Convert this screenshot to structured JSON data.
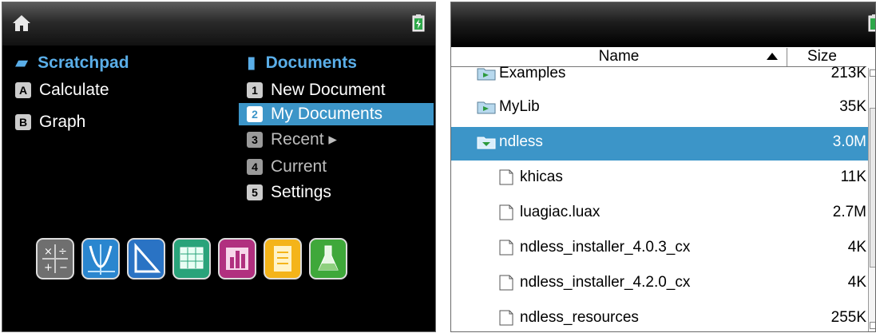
{
  "left_screen": {
    "scratchpad": {
      "title": "Scratchpad",
      "items": [
        {
          "key": "A",
          "label": "Calculate"
        },
        {
          "key": "B",
          "label": "Graph"
        }
      ]
    },
    "documents": {
      "title": "Documents",
      "items": [
        {
          "key": "1",
          "label": "New Document",
          "state": "normal"
        },
        {
          "key": "2",
          "label": "My Documents",
          "state": "selected"
        },
        {
          "key": "3",
          "label": "Recent ▸",
          "state": "dim"
        },
        {
          "key": "4",
          "label": "Current",
          "state": "dim"
        },
        {
          "key": "5",
          "label": "Settings",
          "state": "normal"
        }
      ]
    },
    "apps": [
      {
        "name": "calculator-app-icon",
        "color": "#6f6f6f"
      },
      {
        "name": "graphs-app-icon",
        "color": "#2a86cf"
      },
      {
        "name": "geometry-app-icon",
        "color": "#2a73c4"
      },
      {
        "name": "lists-spreadsheet-app-icon",
        "color": "#29a37a"
      },
      {
        "name": "data-statistics-app-icon",
        "color": "#b1307f"
      },
      {
        "name": "notes-app-icon",
        "color": "#f4b41a"
      },
      {
        "name": "vernier-dataquest-app-icon",
        "color": "#3fa83a"
      }
    ]
  },
  "right_screen": {
    "columns": {
      "name": "Name",
      "size": "Size"
    },
    "rows": [
      {
        "type": "folder",
        "name": "Examples",
        "size": "213K",
        "selected": false
      },
      {
        "type": "folder",
        "name": "MyLib",
        "size": "35K",
        "selected": false
      },
      {
        "type": "folder-open",
        "name": "ndless",
        "size": "3.0M",
        "selected": true
      },
      {
        "type": "file",
        "name": "khicas",
        "size": "11K",
        "selected": false
      },
      {
        "type": "file",
        "name": "luagiac.luax",
        "size": "2.7M",
        "selected": false
      },
      {
        "type": "file",
        "name": "ndless_installer_4.0.3_cx",
        "size": "4K",
        "selected": false
      },
      {
        "type": "file",
        "name": "ndless_installer_4.2.0_cx",
        "size": "4K",
        "selected": false
      },
      {
        "type": "file",
        "name": "ndless_resources",
        "size": "255K",
        "selected": false
      }
    ]
  },
  "colors": {
    "accent": "#3c95c8",
    "title_blue": "#5aaee8"
  }
}
